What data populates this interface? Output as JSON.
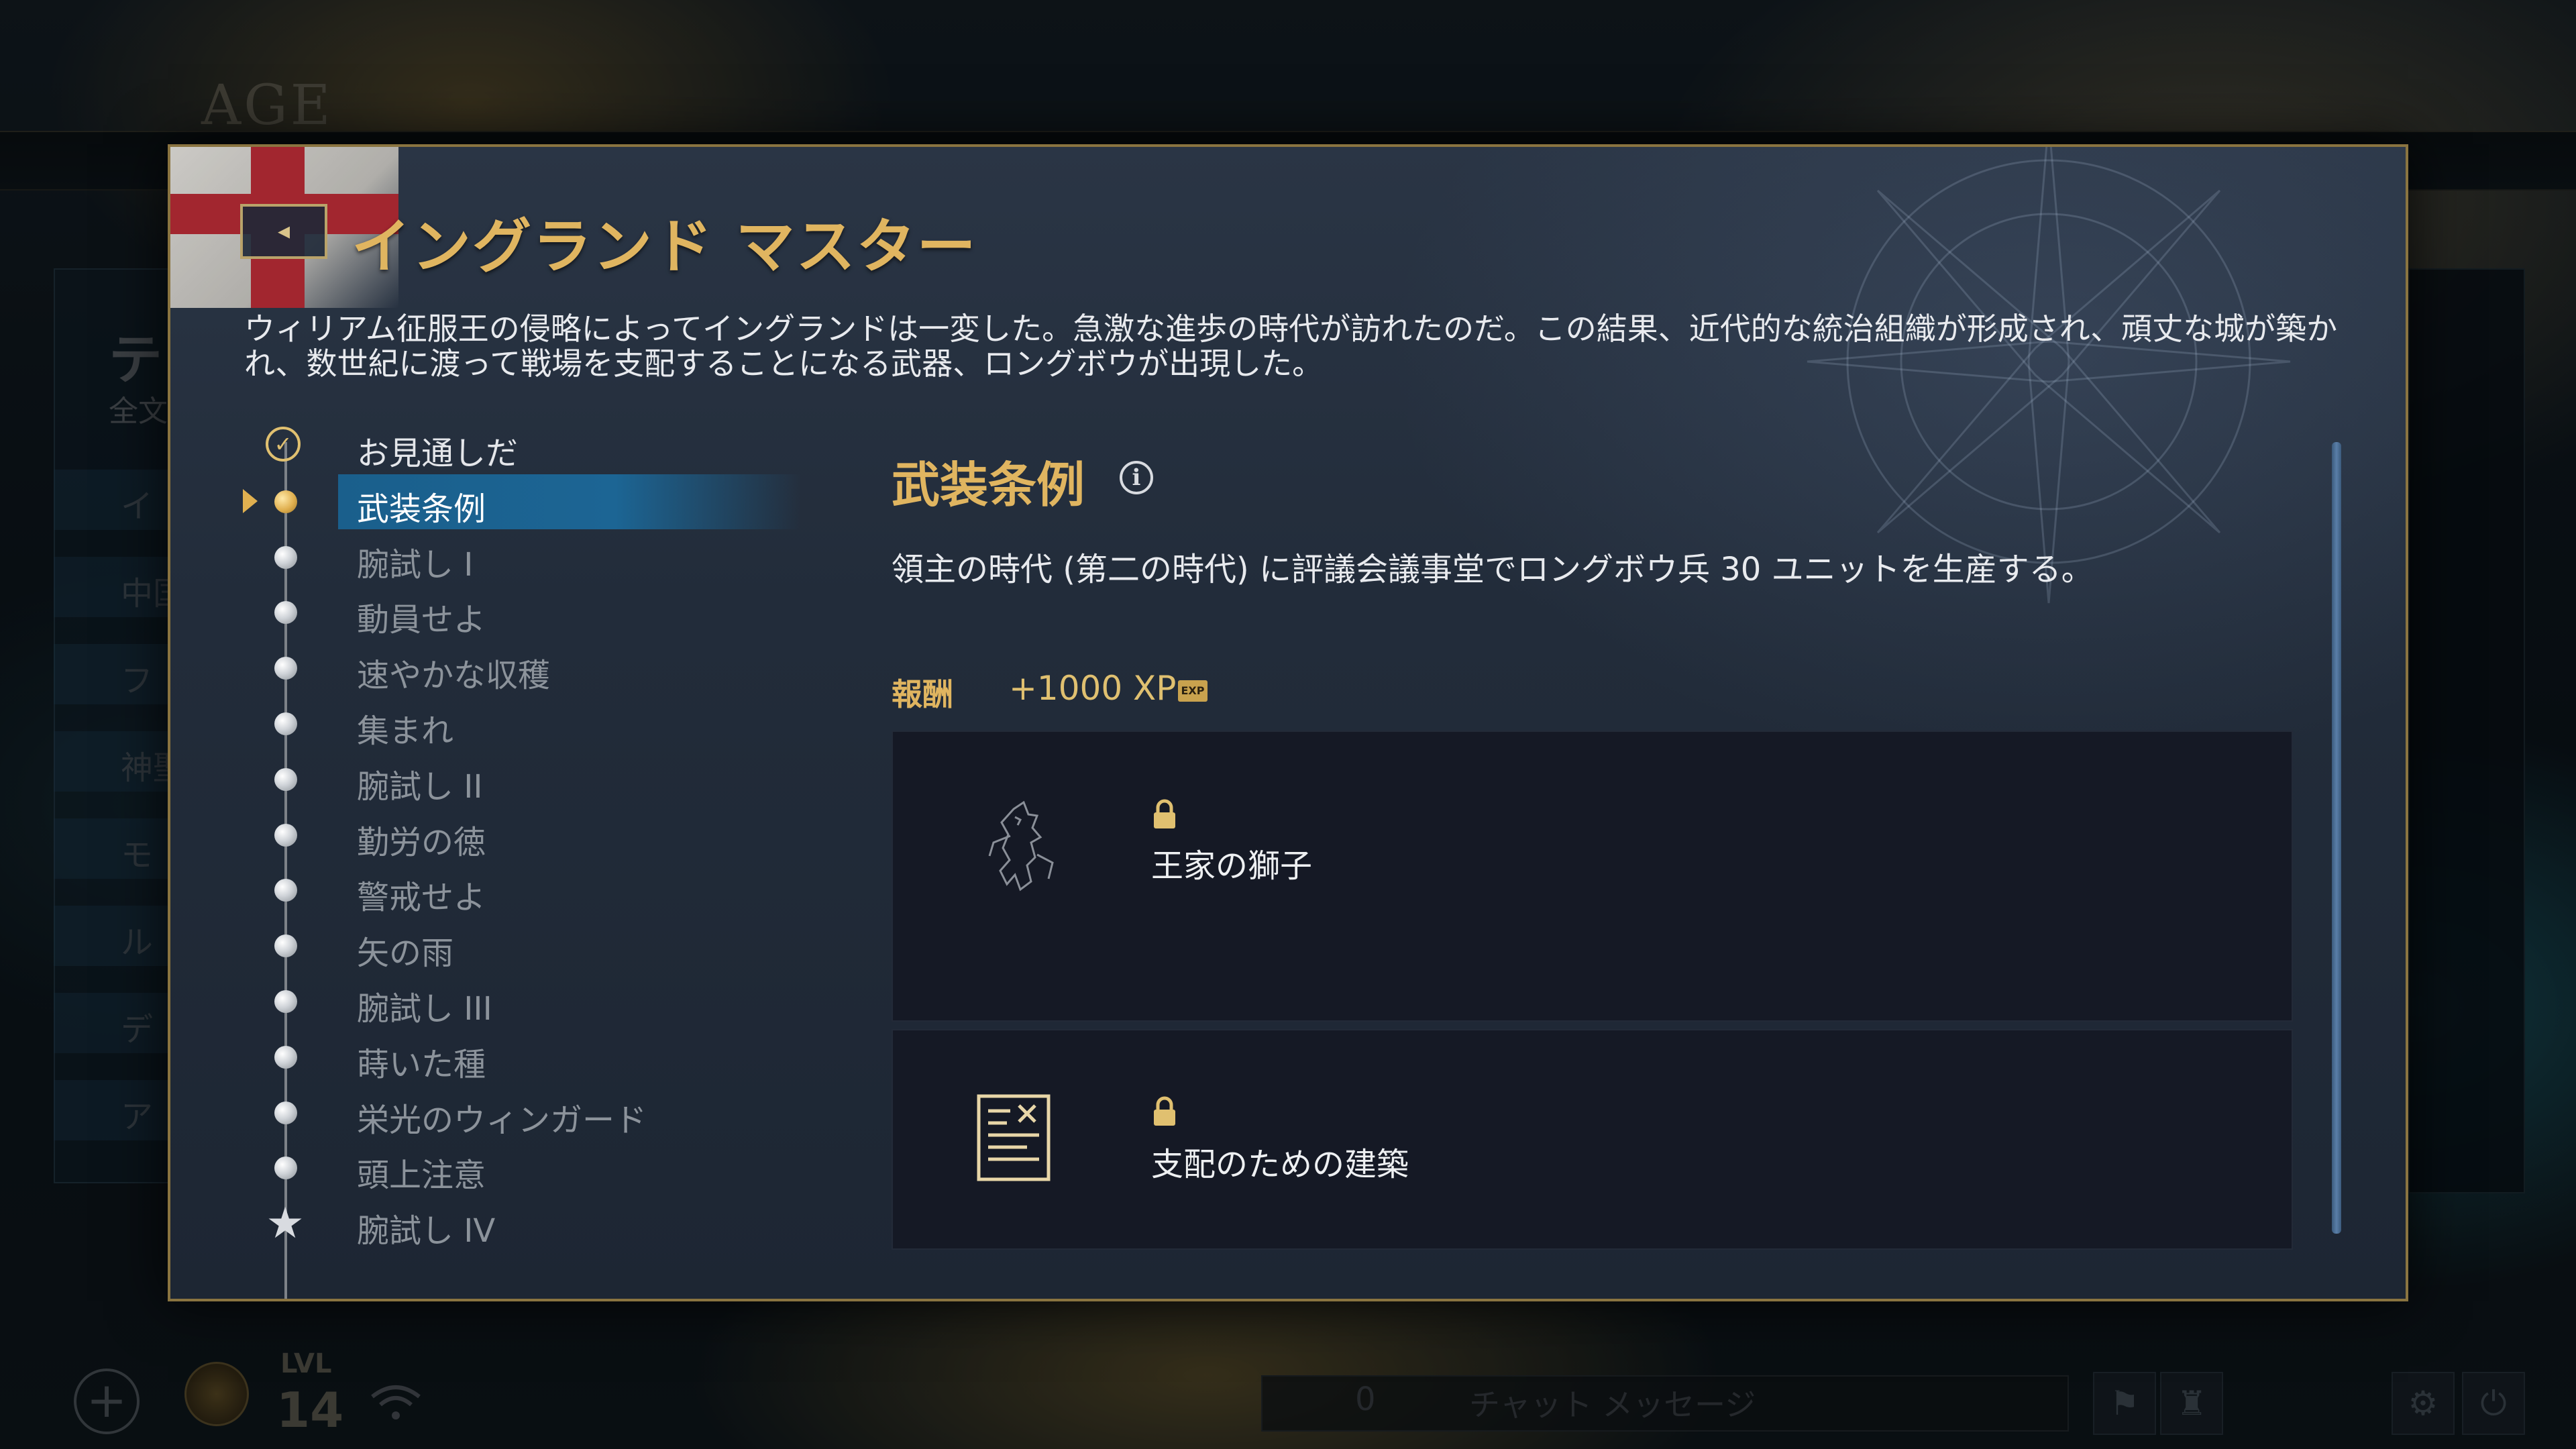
{
  "background": {
    "logo": "AGE",
    "side_title": "テ",
    "side_subtitle": "全文",
    "side_items": [
      "イ",
      "中国",
      "フ",
      "神聖",
      "モ",
      "ル",
      "デ",
      "ア"
    ],
    "bottom": {
      "lvl_label": "LVL",
      "lvl_value": "14",
      "chat_count": "0",
      "chat_placeholder": "チャット メッセージ"
    }
  },
  "modal": {
    "back_icon": "chevron-left-icon",
    "title": "イングランド マスター",
    "intro": "ウィリアム征服王の侵略によってイングランドは一変した。急激な進歩の時代が訪れたのだ。この結果、近代的な統治組織が形成され、頑丈な城が築かれ、数世紀に渡って戦場を支配することになる武器、ロングボウが出現した。",
    "steps": [
      {
        "label": "お見通しだ",
        "state": "done"
      },
      {
        "label": "武装条例",
        "state": "active"
      },
      {
        "label": "腕試し I",
        "state": "locked"
      },
      {
        "label": "動員せよ",
        "state": "locked"
      },
      {
        "label": "速やかな収穫",
        "state": "locked"
      },
      {
        "label": "集まれ",
        "state": "locked"
      },
      {
        "label": "腕試し II",
        "state": "locked"
      },
      {
        "label": "勤労の徳",
        "state": "locked"
      },
      {
        "label": "警戒せよ",
        "state": "locked"
      },
      {
        "label": "矢の雨",
        "state": "locked"
      },
      {
        "label": "腕試し III",
        "state": "locked"
      },
      {
        "label": "蒔いた種",
        "state": "locked"
      },
      {
        "label": "栄光のウィンガード",
        "state": "locked"
      },
      {
        "label": "頭上注意",
        "state": "locked"
      },
      {
        "label": "腕試し IV",
        "state": "final"
      }
    ],
    "detail": {
      "title": "武装条例",
      "description": "領主の時代 (第二の時代) に評議会議事堂でロングボウ兵 30 ユニットを生産する。",
      "reward_label": "報酬",
      "reward_value": "+1000 XP",
      "exp_badge": "EXP",
      "rewards": [
        {
          "name": "王家の獅子",
          "icon": "lion-emblem-icon",
          "locked": true
        },
        {
          "name": "支配のための建築",
          "icon": "blueprint-icon",
          "locked": true
        }
      ]
    }
  },
  "colors": {
    "gold": "#e0b560",
    "active_highlight": "#1a5f8c",
    "card_bg": "#151925",
    "modal_border": "#8a7440"
  }
}
